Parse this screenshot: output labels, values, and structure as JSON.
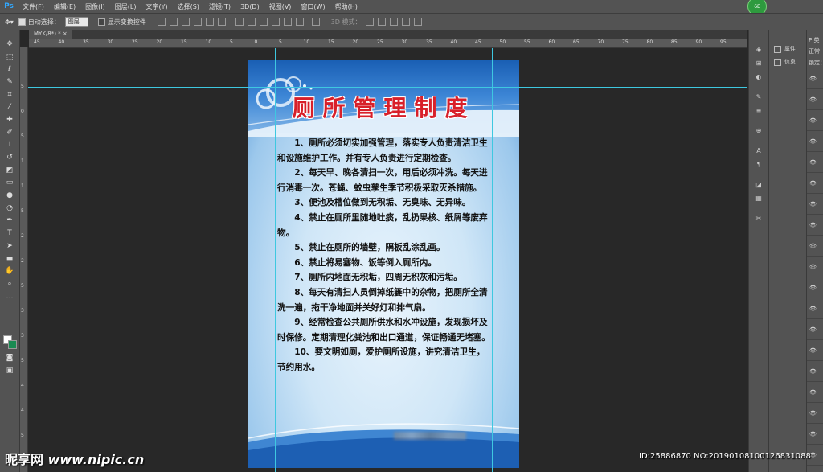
{
  "app": {
    "logo": "Ps",
    "badge": "6E"
  },
  "menu": [
    "文件(F)",
    "编辑(E)",
    "图像(I)",
    "图层(L)",
    "文字(Y)",
    "选择(S)",
    "滤镜(T)",
    "3D(D)",
    "视图(V)",
    "窗口(W)",
    "帮助(H)"
  ],
  "options": {
    "auto_select_label": "自动选择：",
    "auto_select_value": "图层",
    "show_transform_label": "显示变换控件",
    "mode_3d_label": "3D 模式："
  },
  "tab": {
    "title": "MYK/8*) *"
  },
  "ruler_top": [
    "45",
    "40",
    "35",
    "30",
    "25",
    "20",
    "15",
    "10",
    "5",
    "0",
    "5",
    "10",
    "15",
    "20",
    "25",
    "30",
    "35",
    "40",
    "45",
    "50",
    "55",
    "60",
    "65",
    "70",
    "75",
    "80",
    "85",
    "90",
    "95"
  ],
  "ruler_left": [
    "5",
    "0",
    "5",
    "1",
    "1",
    "5",
    "2",
    "2",
    "5",
    "3",
    "3",
    "5",
    "4",
    "4",
    "5",
    "5"
  ],
  "document": {
    "title": "厕所管理制度",
    "paragraphs": [
      "1、厕所必须切实加强管理，落实专人负责清洁卫生和设施维护工作。并有专人负责进行定期检查。",
      "2、每天早、晚各清扫一次，用后必须冲洗。每天进行消毒一次。苍蝇、蚊虫孳生季节积极采取灭杀措施。",
      "3、便池及槽位做到无积垢、无臭味、无异味。",
      "4、禁止在厕所里随地吐痰，乱扔果核、纸屑等废弃物。",
      "5、禁止在厕所的墙壁，隔板乱涂乱画。",
      "6、禁止将易塞物、饭等倒入厕所内。",
      "7、厕所内地面无积垢，四周无积灰和污垢。",
      "8、每天有清扫人员倒掉纸篓中的杂物，把厕所全清洗一遍，拖干净地面并关好灯和排气扇。",
      "9、经常检查公共厕所供水和水冲设施，发现损坏及时保修。定期清理化粪池和出口通道，保证畅通无堵塞。",
      "10、要文明如厕，爱护厕所设施，讲究清洁卫生，节约用水。"
    ]
  },
  "panels": {
    "properties_label": "属性",
    "info_label": "信息",
    "layer_header": "P 类",
    "blend_mode": "正常",
    "lock_label": "锁定："
  },
  "watermark": {
    "site_cn": "昵享网",
    "site_url": "www.nipic.cn",
    "id_text": "ID:25886870 NO:20190108100126831088"
  }
}
